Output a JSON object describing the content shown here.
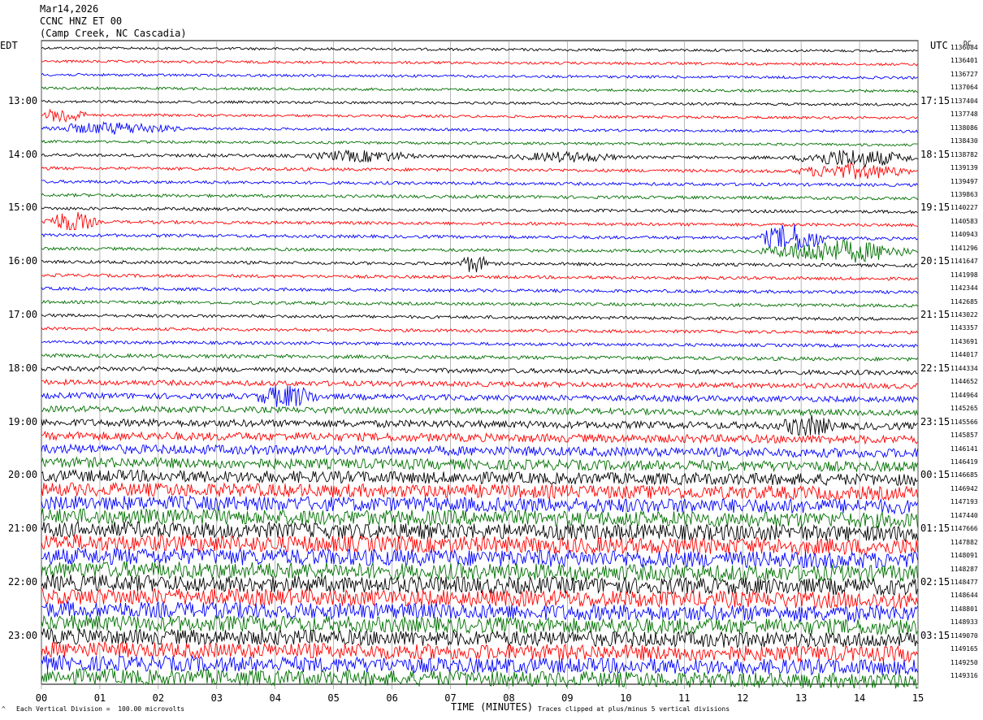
{
  "header": {
    "date": "Mar14,2026",
    "station": "CCNC HNZ ET 00",
    "location": "(Camp Creek, NC Cascadia)"
  },
  "left_axis_label": "EDT",
  "right_axis_label": "UTC",
  "dc_label": "DC",
  "footer": {
    "scale_note": "Each Vertical Division =  100.00 microvolts",
    "xlabel": "TIME (MINUTES)",
    "clip_note": "Traces clipped at plus/minus 5 vertical divisions",
    "corner_mark": "^"
  },
  "colors": {
    "trace_cycle": [
      "#000000",
      "#ff0000",
      "#0000ff",
      "#007000"
    ],
    "grid": "#888888"
  },
  "chart_data": {
    "type": "line",
    "title": "CCNC HNZ ET 00",
    "xlabel": "TIME (MINUTES)",
    "xlim": [
      0,
      15
    ],
    "x_ticks": [
      "00",
      "01",
      "02",
      "03",
      "04",
      "05",
      "06",
      "07",
      "08",
      "09",
      "10",
      "11",
      "12",
      "13",
      "14",
      "15"
    ],
    "y_ticks_left_edt": [
      "13:00",
      "14:00",
      "15:00",
      "16:00",
      "17:00",
      "18:00",
      "19:00",
      "20:00",
      "21:00",
      "22:00",
      "23:00"
    ],
    "y_ticks_right_utc": [
      "17:15",
      "18:15",
      "19:15",
      "20:15",
      "21:15",
      "22:15",
      "23:15",
      "00:15",
      "01:15",
      "02:15",
      "03:15"
    ],
    "trace_interval_minutes": 15,
    "clip_divisions": 5,
    "division_microvolts": 100.0,
    "dc_offsets": [
      1136084,
      1136401,
      1136727,
      1137064,
      1137404,
      1137748,
      1138086,
      1138430,
      1138782,
      1139139,
      1139497,
      1139863,
      1140227,
      1140583,
      1140943,
      1141296,
      1141647,
      1141998,
      1142344,
      1142685,
      1143022,
      1143357,
      1143691,
      1144017,
      1144334,
      1144652,
      1144964,
      1145265,
      1145566,
      1145857,
      1146141,
      1146419,
      1146685,
      1146942,
      1147193,
      1147440,
      1147666,
      1147882,
      1148091,
      1148287,
      1148477,
      1148644,
      1148801,
      1148933,
      1149070,
      1149165,
      1149250,
      1149316
    ],
    "trace_noise_level": [
      0.5,
      0.5,
      0.5,
      0.5,
      0.5,
      0.5,
      0.5,
      0.5,
      0.6,
      0.6,
      0.6,
      0.6,
      0.6,
      0.6,
      0.6,
      0.6,
      0.6,
      0.6,
      0.6,
      0.6,
      0.6,
      0.6,
      0.6,
      0.7,
      0.9,
      1.0,
      1.1,
      1.2,
      1.4,
      1.6,
      1.8,
      2.0,
      2.3,
      2.6,
      2.8,
      3.0,
      3.1,
      3.2,
      3.2,
      3.2,
      3.2,
      3.2,
      3.1,
      3.1,
      3.0,
      3.0,
      3.0,
      3.0
    ],
    "events": [
      {
        "trace": 5,
        "start_min": 0.0,
        "end_min": 0.8,
        "amp": 3.0
      },
      {
        "trace": 6,
        "start_min": 0.0,
        "end_min": 2.5,
        "amp": 2.0
      },
      {
        "trace": 8,
        "start_min": 4.5,
        "end_min": 6.5,
        "amp": 1.8
      },
      {
        "trace": 8,
        "start_min": 8.0,
        "end_min": 10.0,
        "amp": 1.5
      },
      {
        "trace": 8,
        "start_min": 12.8,
        "end_min": 15.0,
        "amp": 3.0
      },
      {
        "trace": 9,
        "start_min": 12.8,
        "end_min": 15.0,
        "amp": 2.5
      },
      {
        "trace": 13,
        "start_min": 0.0,
        "end_min": 1.0,
        "amp": 3.5
      },
      {
        "trace": 14,
        "start_min": 12.2,
        "end_min": 13.5,
        "amp": 5.0
      },
      {
        "trace": 15,
        "start_min": 12.2,
        "end_min": 15.0,
        "amp": 4.0
      },
      {
        "trace": 16,
        "start_min": 7.1,
        "end_min": 7.7,
        "amp": 3.0
      },
      {
        "trace": 26,
        "start_min": 3.6,
        "end_min": 4.8,
        "amp": 3.5
      },
      {
        "trace": 28,
        "start_min": 12.6,
        "end_min": 13.6,
        "amp": 3.0
      }
    ]
  }
}
